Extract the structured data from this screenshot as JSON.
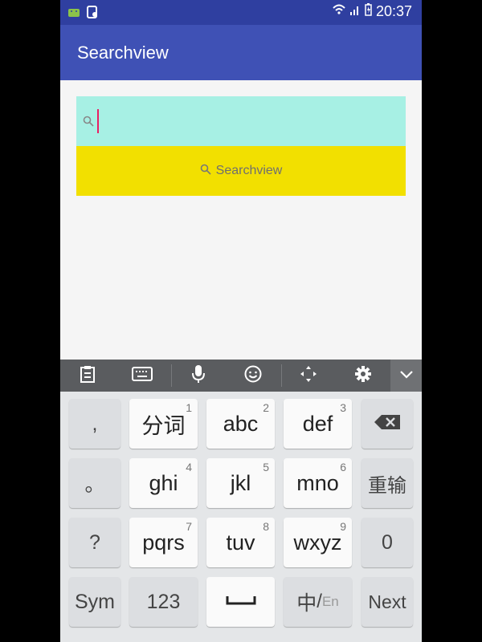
{
  "status_bar": {
    "time": "20:37"
  },
  "app_bar": {
    "title": "Searchview"
  },
  "search_views": [
    {
      "value": ""
    },
    {
      "hint": "Searchview"
    }
  ],
  "keyboard": {
    "side_keys": [
      ",",
      "。",
      "?",
      "Sym"
    ],
    "center_keys": [
      {
        "label": "分词",
        "number": "1"
      },
      {
        "label": "abc",
        "number": "2"
      },
      {
        "label": "def",
        "number": "3"
      },
      {
        "label": "ghi",
        "number": "4"
      },
      {
        "label": "jkl",
        "number": "5"
      },
      {
        "label": "mno",
        "number": "6"
      },
      {
        "label": "pqrs",
        "number": "7"
      },
      {
        "label": "tuv",
        "number": "8"
      },
      {
        "label": "wxyz",
        "number": "9"
      }
    ],
    "right_keys": {
      "retype": "重输",
      "zero": "0",
      "next": "Next"
    },
    "bottom": {
      "num_mode": "123",
      "lang_zh": "中",
      "lang_sep": "/",
      "lang_en": "En"
    }
  },
  "colors": {
    "app_bar": "#3f51b5",
    "status_bar": "#2f3fa0",
    "search_box_1": "#a7f0e4",
    "search_box_2": "#f2e000",
    "cursor": "#e91e63"
  },
  "icons": [
    "android-icon",
    "sim-icon",
    "wifi-icon",
    "signal-icon",
    "battery-icon",
    "search-icon",
    "clipboard-icon",
    "keyboard-icon",
    "mic-icon",
    "emoji-icon",
    "move-cursor-icon",
    "gear-icon",
    "chevron-down-icon",
    "backspace-icon",
    "space-icon"
  ]
}
